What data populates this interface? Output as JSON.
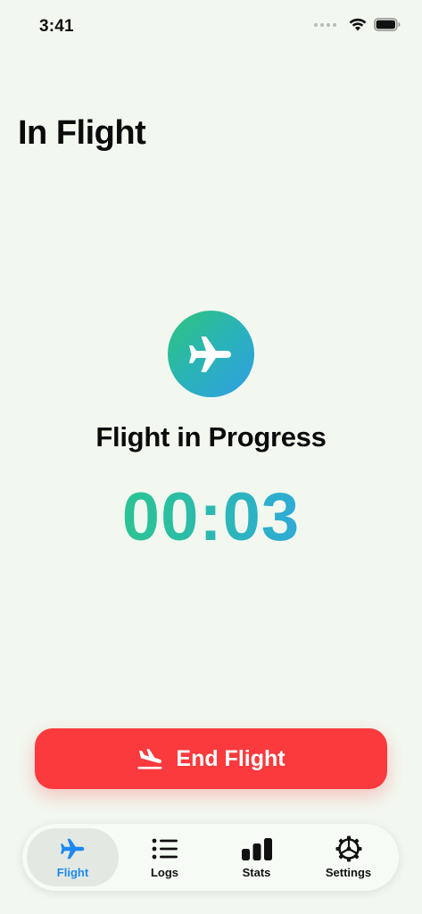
{
  "status_bar": {
    "time": "3:41",
    "icons": [
      "signal-dots-icon",
      "wifi-icon",
      "battery-icon"
    ]
  },
  "page": {
    "title": "In Flight"
  },
  "flight_status": {
    "icon": "airplane-icon",
    "label": "Flight in Progress",
    "elapsed": "00:03"
  },
  "actions": {
    "end_flight_label": "End Flight",
    "end_flight_icon": "airplane-landing-icon",
    "end_flight_color": "#fb3a3d"
  },
  "tab_bar": {
    "active_color": "#1e88f2",
    "tabs": [
      {
        "label": "Flight",
        "icon": "airplane-icon",
        "active": true
      },
      {
        "label": "Logs",
        "icon": "list-icon",
        "active": false
      },
      {
        "label": "Stats",
        "icon": "bar-chart-icon",
        "active": false
      },
      {
        "label": "Settings",
        "icon": "gear-icon",
        "active": false
      }
    ]
  }
}
